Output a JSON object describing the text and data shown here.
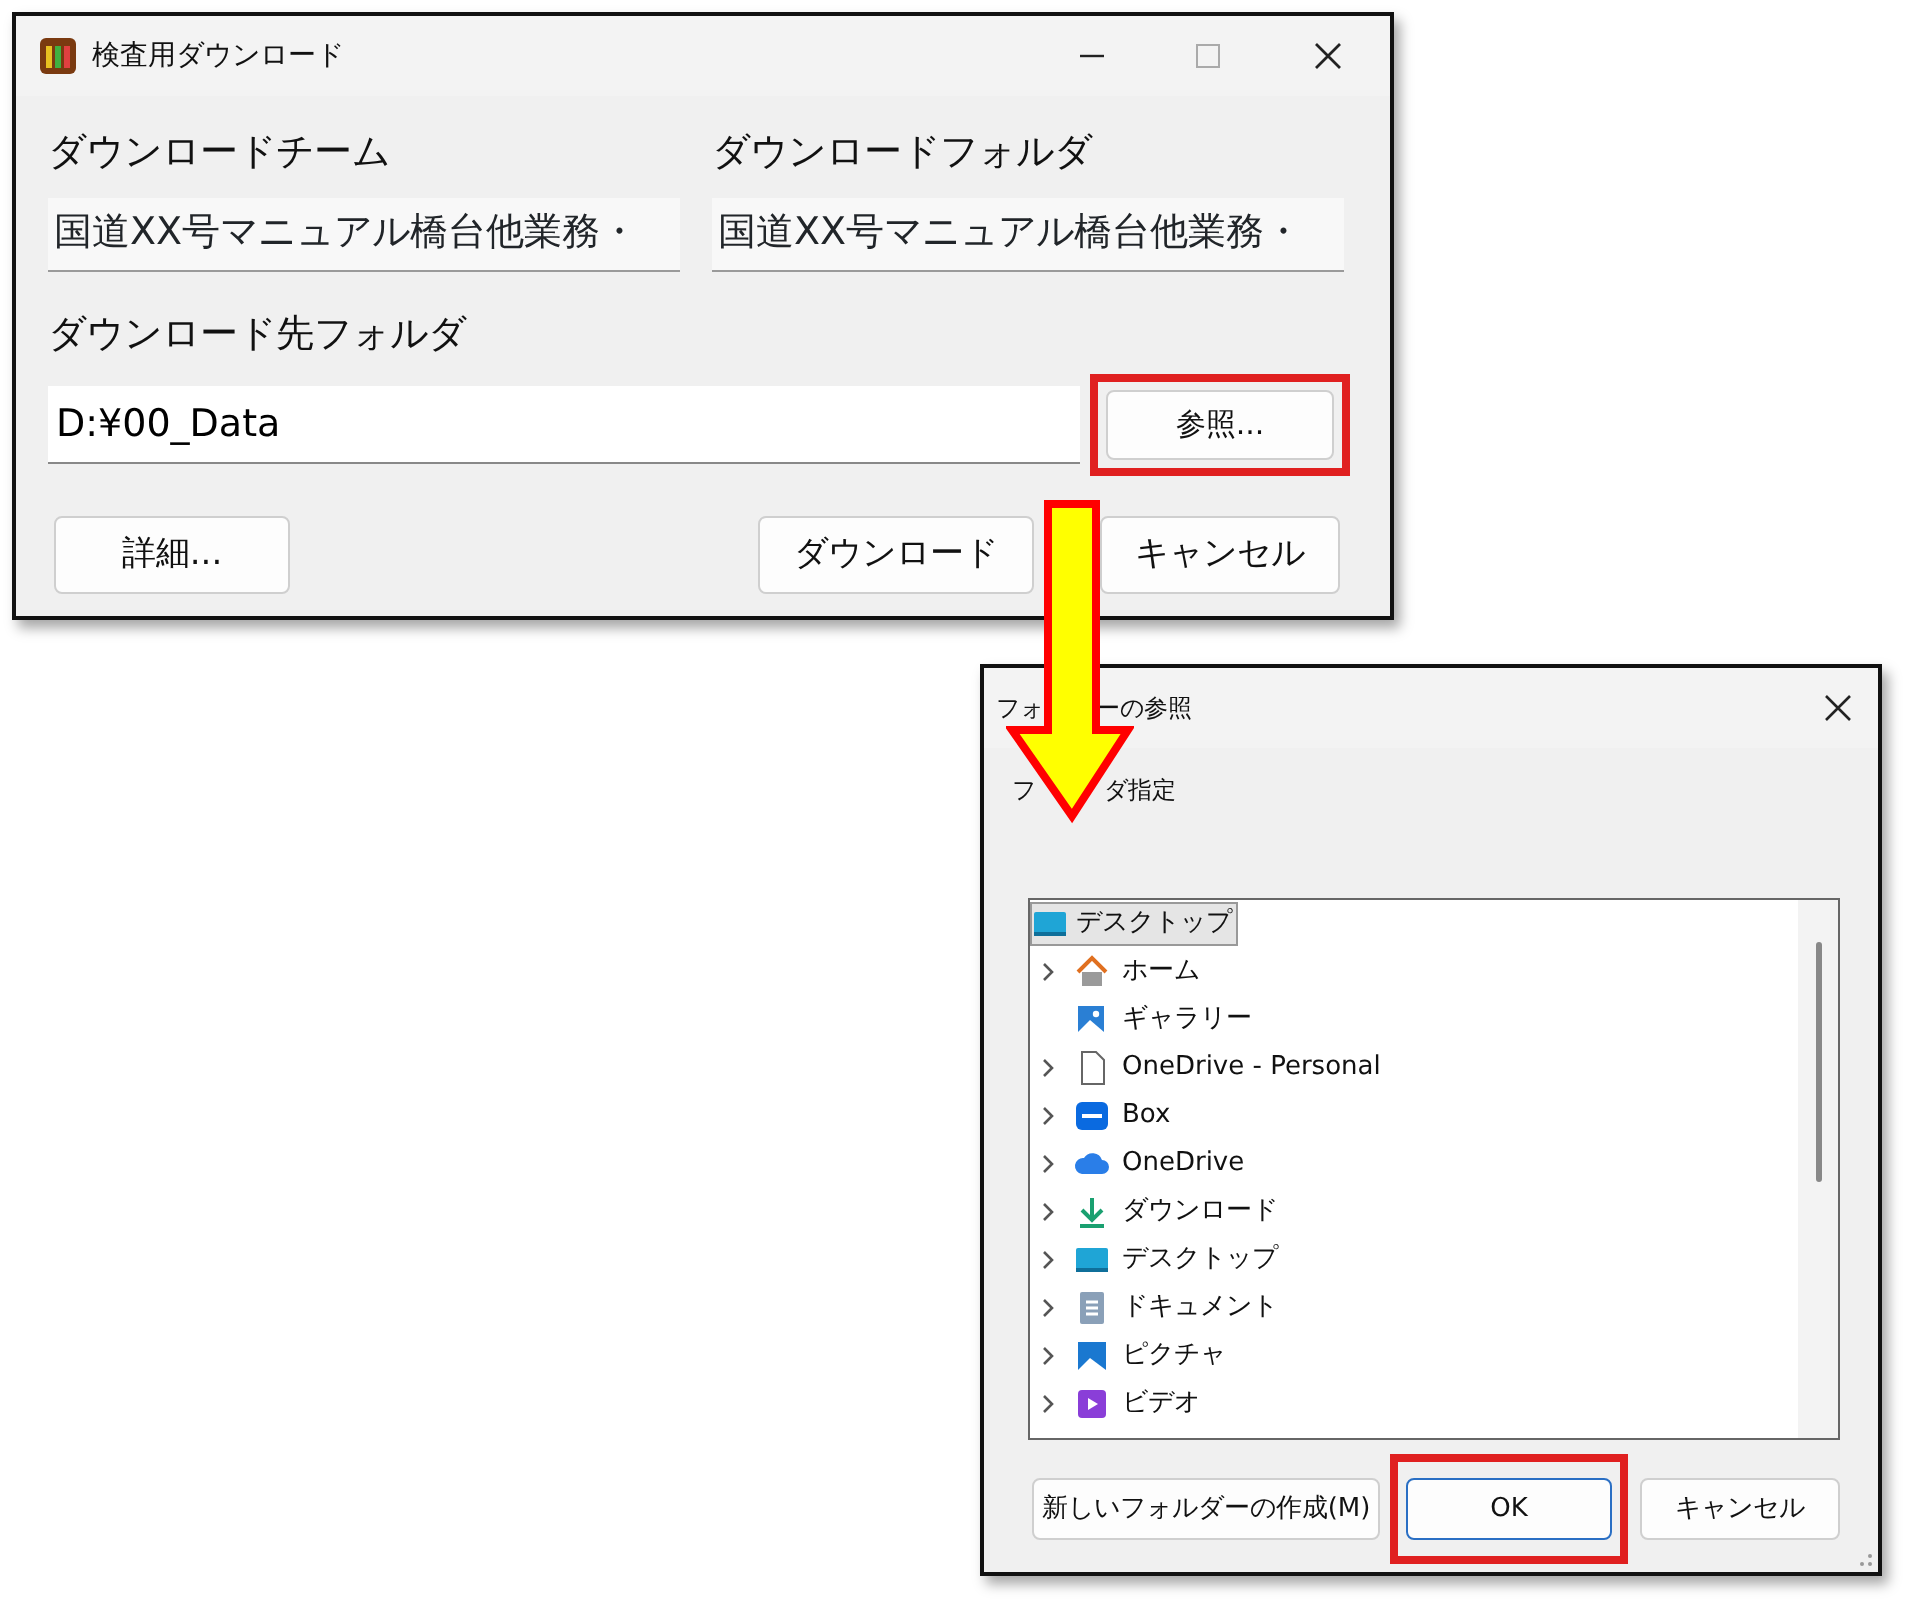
{
  "main_window": {
    "title": "検査用ダウンロード",
    "team": {
      "label": "ダウンロードチーム",
      "value": "国道XX号マニュアル橋台他業務・"
    },
    "folder": {
      "label": "ダウンロードフォルダ",
      "value": "国道XX号マニュアル橋台他業務・"
    },
    "destination": {
      "label": "ダウンロード先フォルダ",
      "value": "D:¥00_Data"
    },
    "browse_button": {
      "label": "参照...",
      "highlighted": true
    },
    "buttons": [
      {
        "label": "詳細...",
        "highlighted": false
      },
      {
        "label": "ダウンロード",
        "highlighted": false
      },
      {
        "label": "キャンセル",
        "highlighted": false
      }
    ]
  },
  "browse_dialog": {
    "title_parts": [
      "フォ",
      "ーの参照"
    ],
    "prompt_parts": [
      "フ",
      "ダ指定"
    ],
    "tree": {
      "label": "デスクトップ",
      "kind": "desktop",
      "selected": true,
      "children": [
        {
          "label": "ホーム",
          "kind": "home",
          "expandable": true
        },
        {
          "label": "ギャラリー",
          "kind": "gallery",
          "expandable": false
        },
        {
          "label": "OneDrive - Personal",
          "kind": "file",
          "expandable": true
        },
        {
          "label": "Box",
          "kind": "box",
          "expandable": true
        },
        {
          "label": "OneDrive",
          "kind": "cloud",
          "expandable": true
        },
        {
          "label": "ダウンロード",
          "kind": "download",
          "expandable": true
        },
        {
          "label": "デスクトップ",
          "kind": "desktop",
          "expandable": true
        },
        {
          "label": "ドキュメント",
          "kind": "document",
          "expandable": true
        },
        {
          "label": "ピクチャ",
          "kind": "picture",
          "expandable": true
        },
        {
          "label": "ビデオ",
          "kind": "video",
          "expandable": true
        }
      ]
    },
    "buttons": [
      {
        "label": "新しいフォルダーの作成(M)",
        "highlighted": false,
        "default": false
      },
      {
        "label": "OK",
        "highlighted": true,
        "default": true
      },
      {
        "label": "キャンセル",
        "highlighted": false,
        "default": false
      }
    ]
  }
}
